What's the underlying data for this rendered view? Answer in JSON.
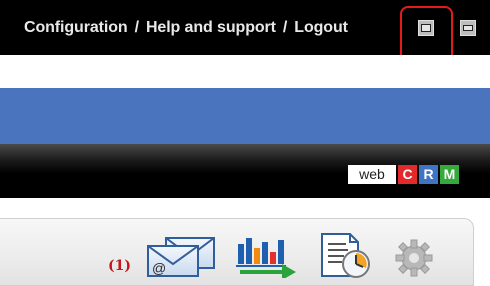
{
  "topbar": {
    "links": [
      "Configuration",
      "Help and support",
      "Logout"
    ],
    "separator": "/"
  },
  "logo": {
    "web": "web",
    "letters": [
      "C",
      "R",
      "M"
    ],
    "letter_colors": [
      "#e32929",
      "#3f74c4",
      "#36a93c"
    ]
  },
  "toolbar": {
    "message_count": "(1)",
    "icons": [
      "email-icon",
      "chart-icon",
      "schedule-document-icon",
      "gear-icon"
    ]
  },
  "colors": {
    "header_bg": "#000000",
    "band_blue": "#4a75be",
    "highlight": "#e41b1b",
    "count_red": "#c01818"
  }
}
